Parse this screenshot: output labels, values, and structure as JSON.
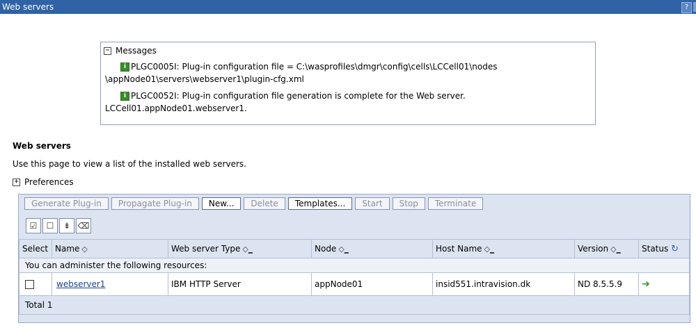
{
  "window": {
    "title": "Web servers",
    "help_label": "?"
  },
  "messages": {
    "header": "Messages",
    "items": [
      {
        "line1": "PLGC0005I: Plug-in configuration file = C:\\wasprofiles\\dmgr\\config\\cells\\LCCell01\\nodes",
        "line2": "\\appNode01\\servers\\webserver1\\plugin-cfg.xml"
      },
      {
        "line1": "PLGC0052I: Plug-in configuration file generation is complete for the Web server.",
        "line2": "LCCell01.appNode01.webserver1."
      }
    ]
  },
  "page": {
    "title": "Web servers",
    "description": "Use this page to view a list of the installed web servers.",
    "preferences": "Preferences"
  },
  "toolbar": {
    "buttons": [
      "Generate Plug-in",
      "Propagate Plug-in",
      "New...",
      "Delete",
      "Templates...",
      "Start",
      "Stop",
      "Terminate"
    ]
  },
  "table": {
    "headers": {
      "select": "Select",
      "name": "Name",
      "type": "Web server Type",
      "node": "Node",
      "host": "Host Name",
      "version": "Version",
      "status": "Status"
    },
    "resources_note": "You can administer the following resources:",
    "rows": [
      {
        "name": "webserver1",
        "type": "IBM HTTP Server",
        "node": "appNode01",
        "host": "insid551.intravision.dk",
        "version": "ND 8.5.5.9",
        "status_icon": "started-arrow-icon"
      }
    ],
    "total": "Total 1"
  }
}
